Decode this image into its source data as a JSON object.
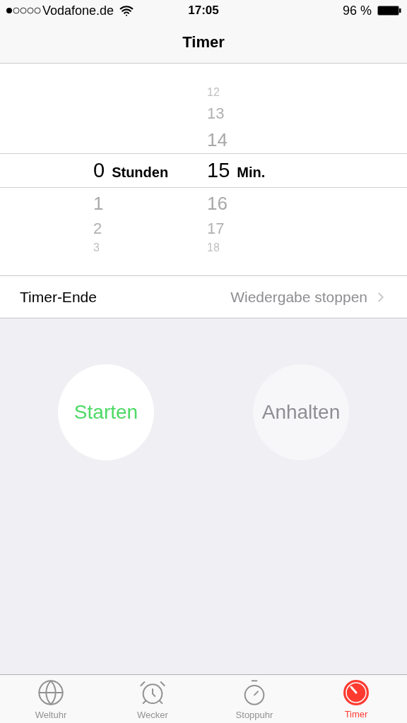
{
  "status_bar": {
    "carrier": "Vodafone.de",
    "time": "17:05",
    "battery": "96 %"
  },
  "nav": {
    "title": "Timer"
  },
  "picker": {
    "columns": [
      {
        "unit": "Stunden",
        "selected": "0",
        "below": [
          "1",
          "2",
          "3"
        ]
      },
      {
        "unit": "Min.",
        "above": [
          "12",
          "13",
          "14"
        ],
        "selected": "15",
        "below": [
          "16",
          "17",
          "18"
        ]
      }
    ]
  },
  "setting": {
    "label": "Timer-Ende",
    "value": "Wiedergabe stoppen"
  },
  "buttons": [
    {
      "label": "Starten",
      "disabled": false
    },
    {
      "label": "Anhalten",
      "disabled": true
    }
  ],
  "tabs": [
    {
      "kind": "globe",
      "label": "Weltuhr",
      "selected": false
    },
    {
      "kind": "alarm",
      "label": "Wecker",
      "selected": false
    },
    {
      "kind": "stopwatch",
      "label": "Stoppuhr",
      "selected": false
    },
    {
      "kind": "timer",
      "label": "Timer",
      "selected": true
    }
  ]
}
